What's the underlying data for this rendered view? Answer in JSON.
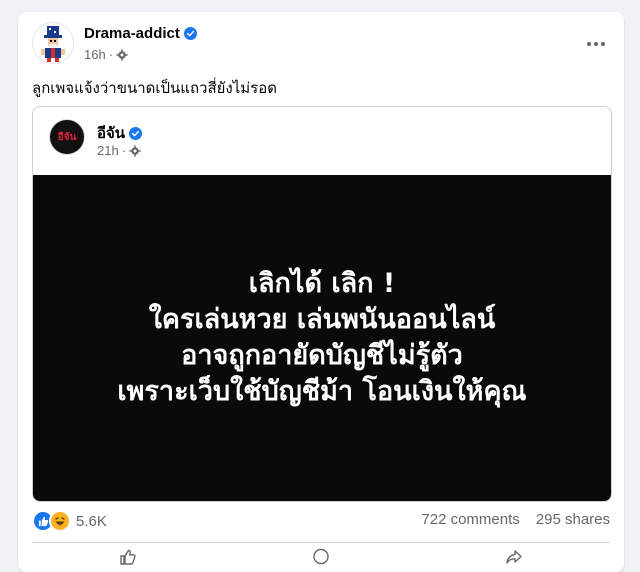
{
  "post": {
    "author": "Drama-addict",
    "time": "16h",
    "caption": "ลูกเพจแจ้งว่าขนาดเป็นแถวสี่ยังไม่รอด"
  },
  "shared_post": {
    "author": "อีจัน",
    "avatar_text": "อีจัน",
    "time": "21h",
    "banner_lines": [
      "เลิกได้ เลิก !",
      "ใครเล่นหวย เล่นพนันออนไลน์",
      "อาจถูกอายัดบัญชีไม่รู้ตัว",
      "เพราะเว็บใช้บัญชีม้า โอนเงินให้คุณ"
    ]
  },
  "stats": {
    "reactions": "5.6K",
    "comments": "722 comments",
    "shares": "295 shares"
  },
  "colors": {
    "verified": "#1877f2",
    "banner_bg": "#0a0a0a",
    "muted_text": "#65676b",
    "page_bg": "#f0f2f5"
  },
  "icons": {
    "verified": "verified-badge-icon",
    "audience": "gear-icon",
    "more": "more-options-icon",
    "like": "like-reaction-icon",
    "haha": "haha-reaction-icon"
  }
}
